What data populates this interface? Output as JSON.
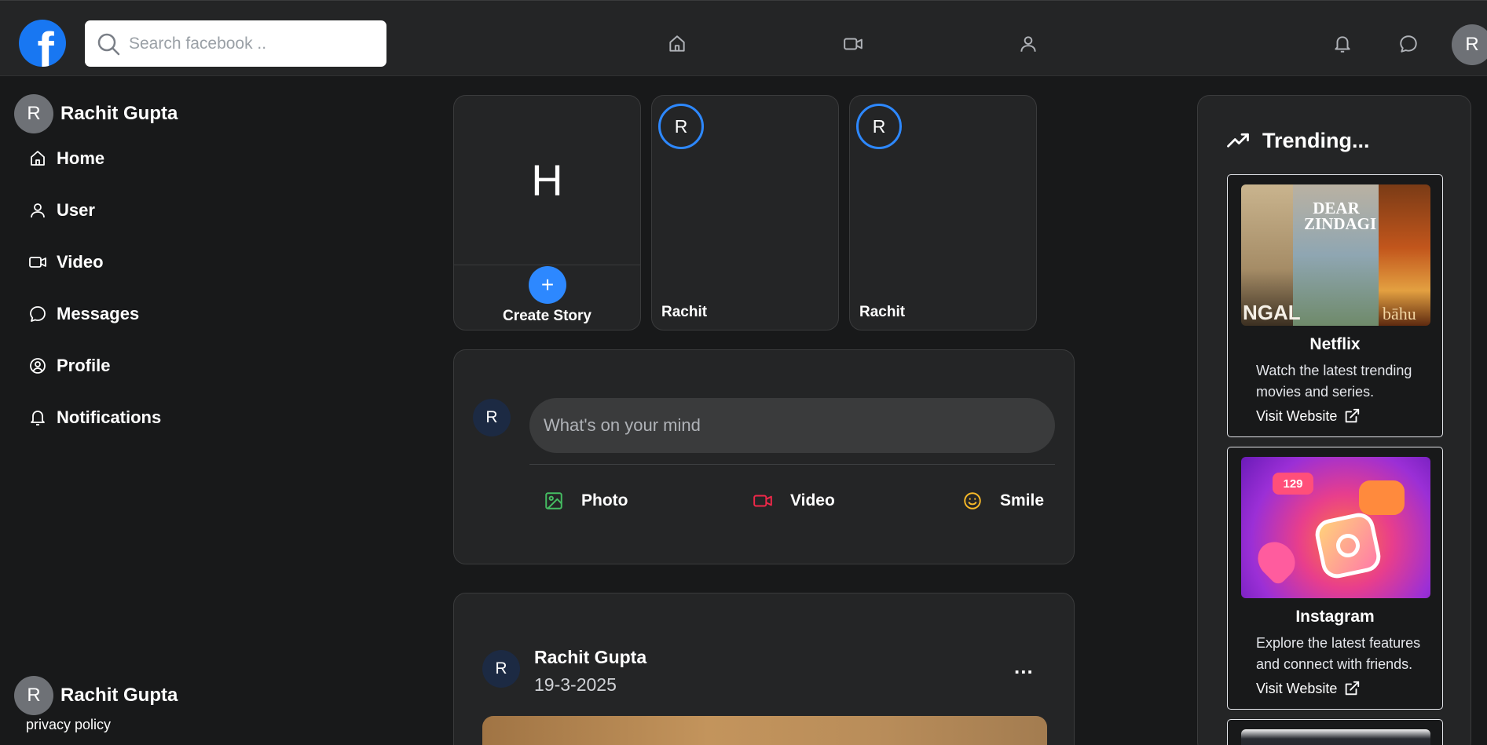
{
  "header": {
    "logo_letter": "f",
    "search_placeholder": "Search facebook ..",
    "avatar_initial": "R"
  },
  "sidebar": {
    "user_initial": "R",
    "user_name": "Rachit Gupta",
    "items": [
      {
        "label": "Home",
        "icon": "home-icon"
      },
      {
        "label": "User",
        "icon": "user-icon"
      },
      {
        "label": "Video",
        "icon": "video-icon"
      },
      {
        "label": "Messages",
        "icon": "message-icon"
      },
      {
        "label": "Profile",
        "icon": "profile-icon"
      },
      {
        "label": "Notifications",
        "icon": "bell-icon"
      }
    ],
    "footer_initial": "R",
    "footer_name": "Rachit Gupta",
    "privacy": "privacy policy"
  },
  "stories": {
    "create_letter": "H",
    "create_plus": "+",
    "create_label": "Create Story",
    "items": [
      {
        "initial": "R",
        "name": "Rachit"
      },
      {
        "initial": "R",
        "name": "Rachit"
      }
    ]
  },
  "composer": {
    "avatar_initial": "R",
    "placeholder": "What's on your mind",
    "actions": [
      {
        "label": "Photo",
        "icon": "photo-icon",
        "color": "#45bd62"
      },
      {
        "label": "Video",
        "icon": "video-icon",
        "color": "#f02849"
      },
      {
        "label": "Smile",
        "icon": "smile-icon",
        "color": "#f7b928"
      }
    ]
  },
  "post": {
    "avatar_initial": "R",
    "author": "Rachit Gupta",
    "date": "19-3-2025",
    "more": "..."
  },
  "trending": {
    "title": "Trending...",
    "cards": [
      {
        "title": "Netflix",
        "description": "Watch the latest trending movies and series.",
        "link": "Visit Website",
        "poster_text": [
          "NGAL",
          "DEAR ZINDAGI",
          "bāhu"
        ]
      },
      {
        "title": "Instagram",
        "description": "Explore the latest features and connect with friends.",
        "link": "Visit Website",
        "badge": "129"
      }
    ]
  },
  "colors": {
    "accent": "#1877f2",
    "story_ring": "#2d88ff"
  }
}
